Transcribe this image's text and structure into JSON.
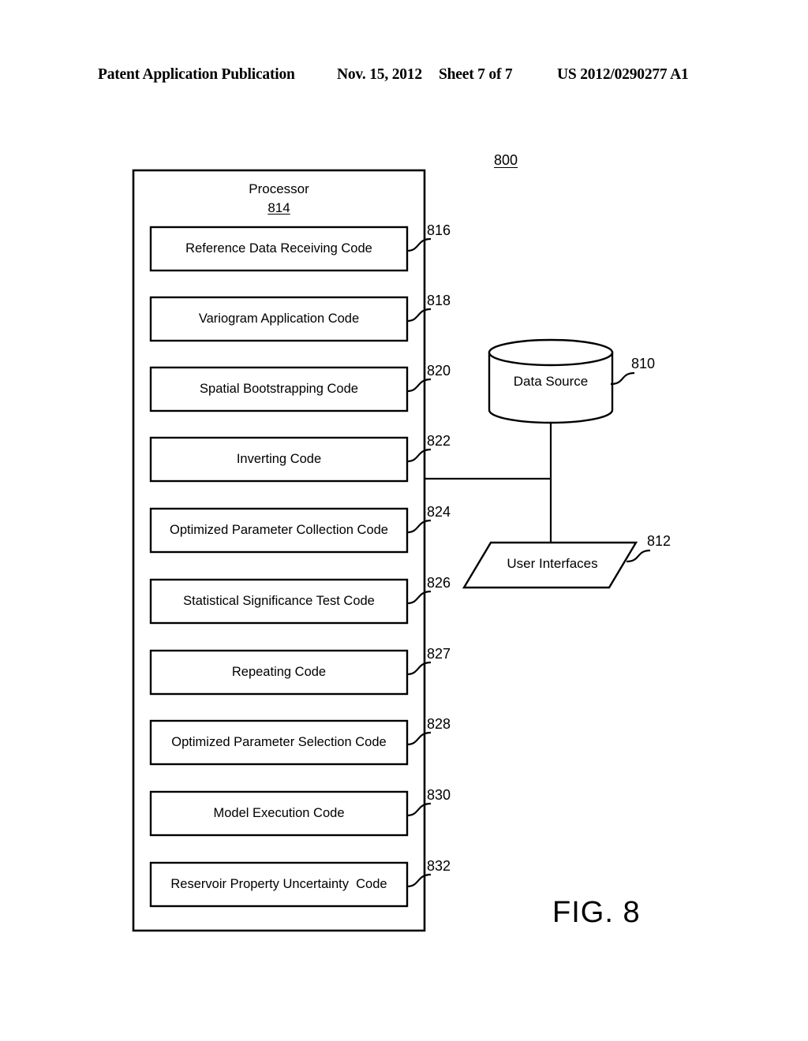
{
  "header": {
    "publication": "Patent Application Publication",
    "date": "Nov. 15, 2012",
    "sheet": "Sheet 7 of 7",
    "number": "US 2012/0290277 A1"
  },
  "figure": {
    "caption": "FIG. 8",
    "system_ref": "800",
    "processor": {
      "title": "Processor",
      "ref": "814"
    },
    "code_modules": [
      {
        "label": "Reference Data Receiving Code",
        "ref": "816"
      },
      {
        "label": "Variogram Application Code",
        "ref": "818"
      },
      {
        "label": "Spatial Bootstrapping Code",
        "ref": "820"
      },
      {
        "label": "Inverting Code",
        "ref": "822"
      },
      {
        "label": "Optimized Parameter Collection Code",
        "ref": "824"
      },
      {
        "label": "Statistical Significance Test Code",
        "ref": "826"
      },
      {
        "label": "Repeating Code",
        "ref": "827"
      },
      {
        "label": "Optimized Parameter Selection Code",
        "ref": "828"
      },
      {
        "label": "Model Execution Code",
        "ref": "830"
      },
      {
        "label": "Reservoir Property Uncertainty  Code",
        "ref": "832"
      }
    ],
    "data_source": {
      "label": "Data Source",
      "ref": "810"
    },
    "user_interfaces": {
      "label": "User Interfaces",
      "ref": "812"
    }
  },
  "colors": {
    "ink": "#000000",
    "paper": "#ffffff"
  }
}
